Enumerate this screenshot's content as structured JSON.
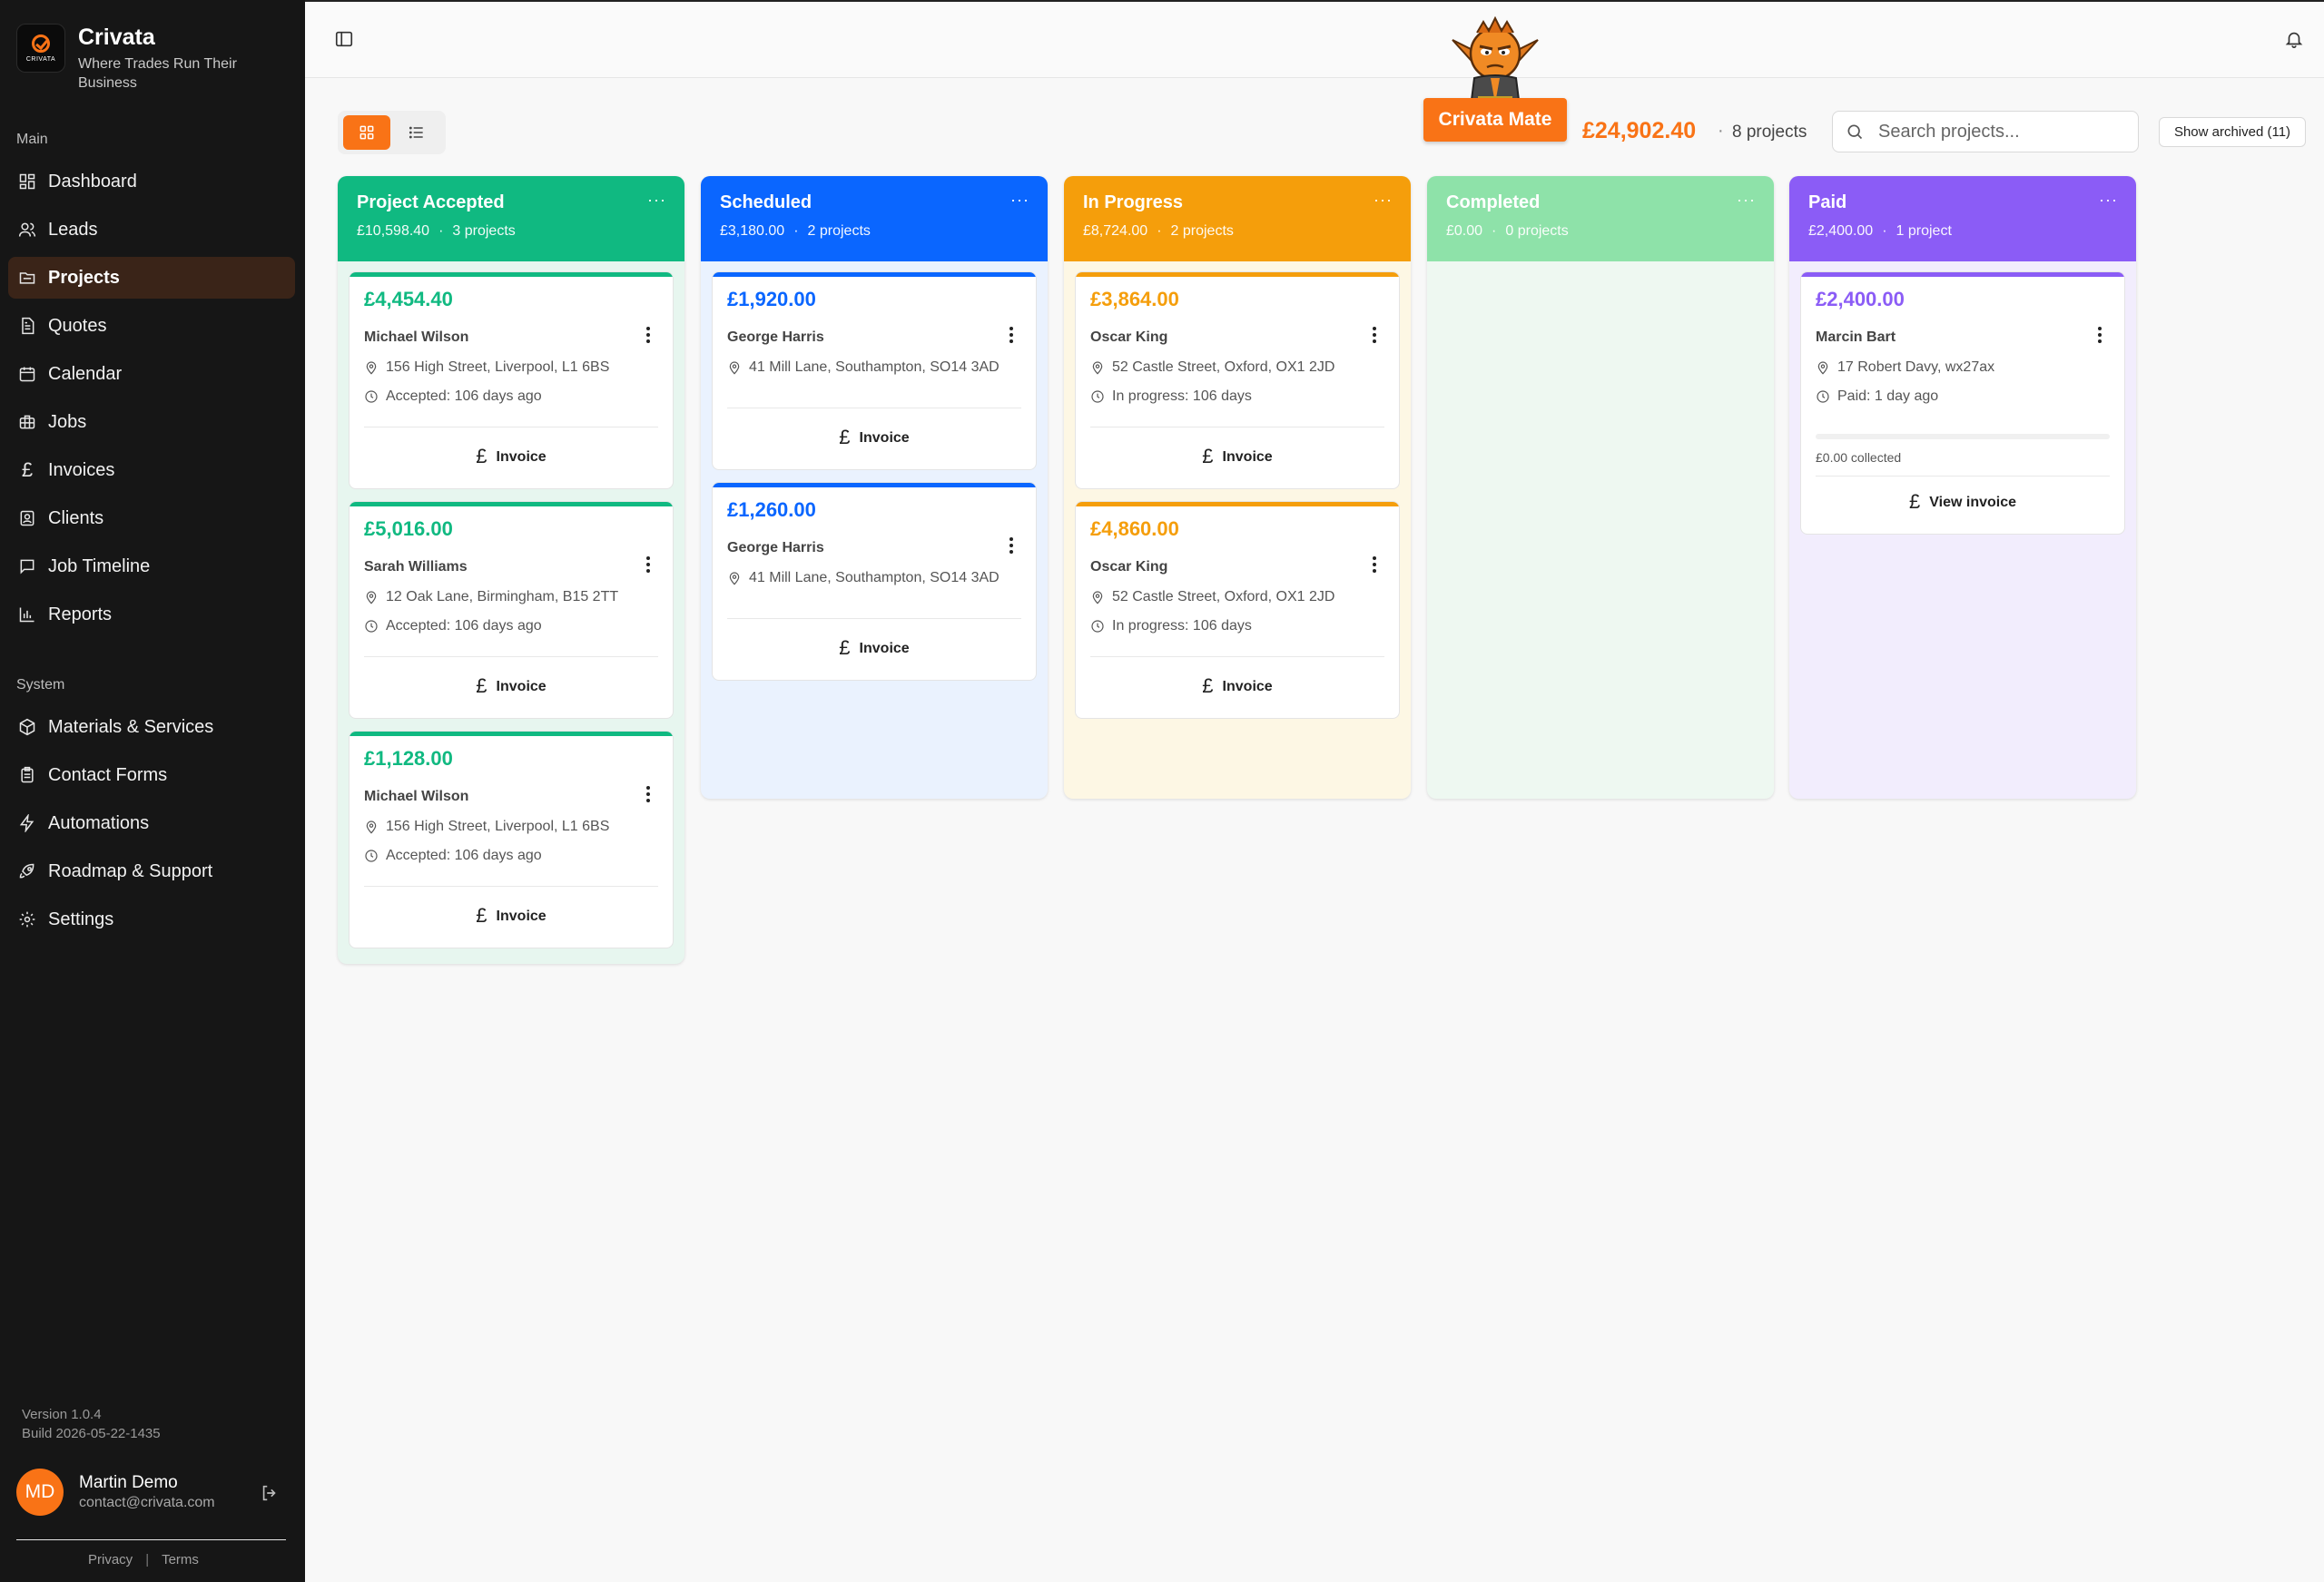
{
  "brand": {
    "name": "Crivata",
    "tagline": "Where Trades Run Their Business",
    "logo_text": "CRIVATA"
  },
  "sidebar": {
    "main_label": "Main",
    "main_items": [
      {
        "label": "Dashboard",
        "icon": "dashboard-icon"
      },
      {
        "label": "Leads",
        "icon": "users-icon"
      },
      {
        "label": "Projects",
        "icon": "folder-icon",
        "active": true
      },
      {
        "label": "Quotes",
        "icon": "file-icon"
      },
      {
        "label": "Calendar",
        "icon": "calendar-icon"
      },
      {
        "label": "Jobs",
        "icon": "briefcase-icon"
      },
      {
        "label": "Invoices",
        "icon": "pound-icon"
      },
      {
        "label": "Clients",
        "icon": "contact-icon"
      },
      {
        "label": "Job Timeline",
        "icon": "message-icon"
      },
      {
        "label": "Reports",
        "icon": "bar-chart-icon"
      }
    ],
    "system_label": "System",
    "system_items": [
      {
        "label": "Materials & Services",
        "icon": "package-icon"
      },
      {
        "label": "Contact Forms",
        "icon": "clipboard-icon"
      },
      {
        "label": "Automations",
        "icon": "zap-icon"
      },
      {
        "label": "Roadmap & Support",
        "icon": "rocket-icon"
      },
      {
        "label": "Settings",
        "icon": "gear-icon"
      }
    ],
    "version": "Version 1.0.4",
    "build": "Build 2026-05-22-1435",
    "user": {
      "initials": "MD",
      "name": "Martin Demo",
      "email": "contact@crivata.com"
    },
    "footer": {
      "privacy": "Privacy",
      "sep": "|",
      "terms": "Terms"
    }
  },
  "header": {
    "mate_button": "Crivata Mate"
  },
  "toolbar": {
    "total_amount": "£24,902.40",
    "total_sep": "·",
    "total_count": "8 projects",
    "search_placeholder": "Search projects...",
    "archived_label": "Show archived (11)",
    "active_view": "grid"
  },
  "colors": {
    "accent": "#f97316",
    "accepted": "#10b981",
    "scheduled": "#0a66ff",
    "in_progress": "#f59e0b",
    "completed": "#8ee2a9",
    "paid": "#8b5cf6"
  },
  "columns": [
    {
      "title": "Project Accepted",
      "total": "£10,598.40",
      "count": "3 projects",
      "more": "···",
      "cards": [
        {
          "amount": "£4,454.40",
          "client": "Michael Wilson",
          "address": "156 High Street, Liverpool, L1 6BS",
          "status": "Accepted: 106 days ago",
          "action": "Invoice"
        },
        {
          "amount": "£5,016.00",
          "client": "Sarah Williams",
          "address": "12 Oak Lane, Birmingham, B15 2TT",
          "status": "Accepted: 106 days ago",
          "action": "Invoice"
        },
        {
          "amount": "£1,128.00",
          "client": "Michael Wilson",
          "address": "156 High Street, Liverpool, L1 6BS",
          "status": "Accepted: 106 days ago",
          "action": "Invoice"
        }
      ]
    },
    {
      "title": "Scheduled",
      "total": "£3,180.00",
      "count": "2 projects",
      "more": "···",
      "cards": [
        {
          "amount": "£1,920.00",
          "client": "George Harris",
          "address": "41 Mill Lane, Southampton, SO14 3AD",
          "action": "Invoice"
        },
        {
          "amount": "£1,260.00",
          "client": "George Harris",
          "address": "41 Mill Lane, Southampton, SO14 3AD",
          "action": "Invoice"
        }
      ]
    },
    {
      "title": "In Progress",
      "total": "£8,724.00",
      "count": "2 projects",
      "more": "···",
      "cards": [
        {
          "amount": "£3,864.00",
          "client": "Oscar King",
          "address": "52 Castle Street, Oxford, OX1 2JD",
          "status": "In progress: 106 days",
          "action": "Invoice"
        },
        {
          "amount": "£4,860.00",
          "client": "Oscar King",
          "address": "52 Castle Street, Oxford, OX1 2JD",
          "status": "In progress: 106 days",
          "action": "Invoice"
        }
      ]
    },
    {
      "title": "Completed",
      "total": "£0.00",
      "count": "0 projects",
      "more": "···",
      "cards": []
    },
    {
      "title": "Paid",
      "total": "£2,400.00",
      "count": "1 project",
      "more": "···",
      "cards": [
        {
          "amount": "£2,400.00",
          "client": "Marcin Bart",
          "address": "17 Robert Davy, wx27ax",
          "status": "Paid: 1 day ago",
          "collected": "£0.00 collected",
          "collected_fraction": 0,
          "action": "View invoice"
        }
      ]
    }
  ]
}
